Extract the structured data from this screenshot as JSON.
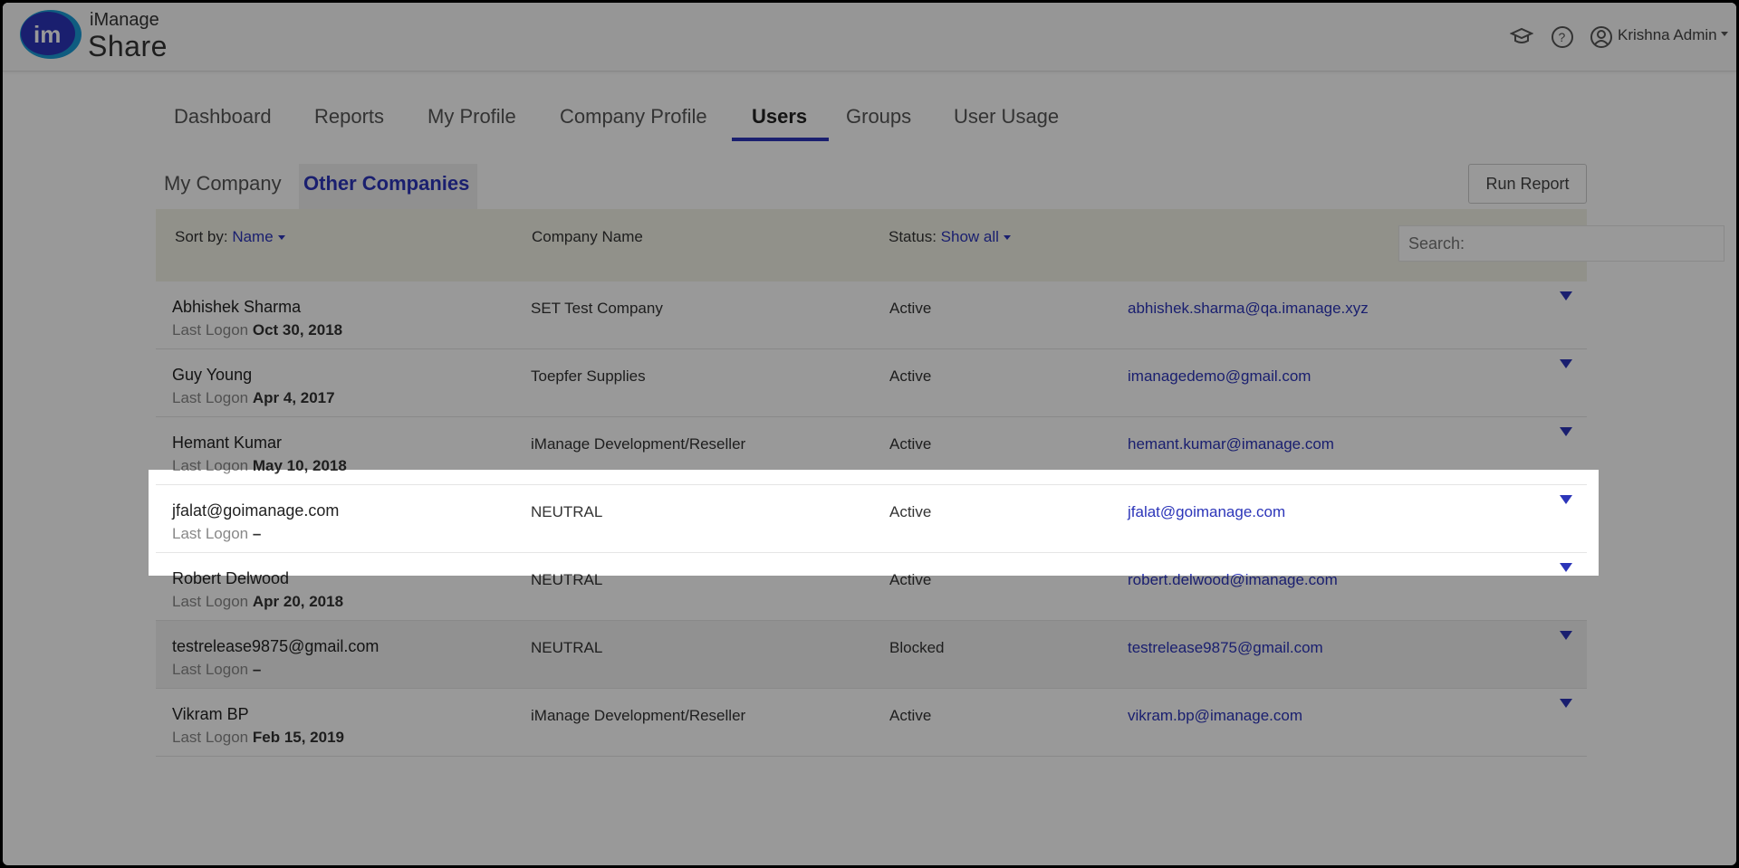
{
  "app": {
    "logo_small": "iManage",
    "logo_big": "Share",
    "user_name": "Krishna Admin"
  },
  "main_tabs": [
    {
      "label": "Dashboard"
    },
    {
      "label": "Reports"
    },
    {
      "label": "My Profile"
    },
    {
      "label": "Company Profile"
    },
    {
      "label": "Users"
    },
    {
      "label": "Groups"
    },
    {
      "label": "User Usage"
    }
  ],
  "sub_tabs": [
    {
      "label": "My Company"
    },
    {
      "label": "Other Companies"
    }
  ],
  "run_report_label": "Run Report",
  "filters": {
    "sort_label": "Sort by:",
    "sort_value": "Name",
    "company_header": "Company Name",
    "status_label": "Status:",
    "status_value": "Show all",
    "search_placeholder": "Search:"
  },
  "last_logon_label": "Last Logon",
  "users": [
    {
      "name": "Abhishek Sharma",
      "last_logon": "Oct 30, 2018",
      "company": "SET Test Company",
      "status": "Active",
      "email": "abhishek.sharma@qa.imanage.xyz"
    },
    {
      "name": "Guy Young",
      "last_logon": "Apr 4, 2017",
      "company": "Toepfer Supplies",
      "status": "Active",
      "email": "imanagedemo@gmail.com"
    },
    {
      "name": "Hemant Kumar",
      "last_logon": "May 10, 2018",
      "company": "iManage Development/Reseller",
      "status": "Active",
      "email": "hemant.kumar@imanage.com"
    },
    {
      "name": "jfalat@goimanage.com",
      "last_logon": "–",
      "company": "NEUTRAL",
      "status": "Active",
      "email": "jfalat@goimanage.com"
    },
    {
      "name": "Robert Delwood",
      "last_logon": "Apr 20, 2018",
      "company": "NEUTRAL",
      "status": "Active",
      "email": "robert.delwood@imanage.com"
    },
    {
      "name": "testrelease9875@gmail.com",
      "last_logon": "–",
      "company": "NEUTRAL",
      "status": "Blocked",
      "email": "testrelease9875@gmail.com"
    },
    {
      "name": "Vikram BP",
      "last_logon": "Feb 15, 2019",
      "company": "iManage Development/Reseller",
      "status": "Active",
      "email": "vikram.bp@imanage.com"
    }
  ],
  "colors": {
    "accent": "#2c35b9",
    "overlay": "rgba(0,0,0,0.4)"
  }
}
